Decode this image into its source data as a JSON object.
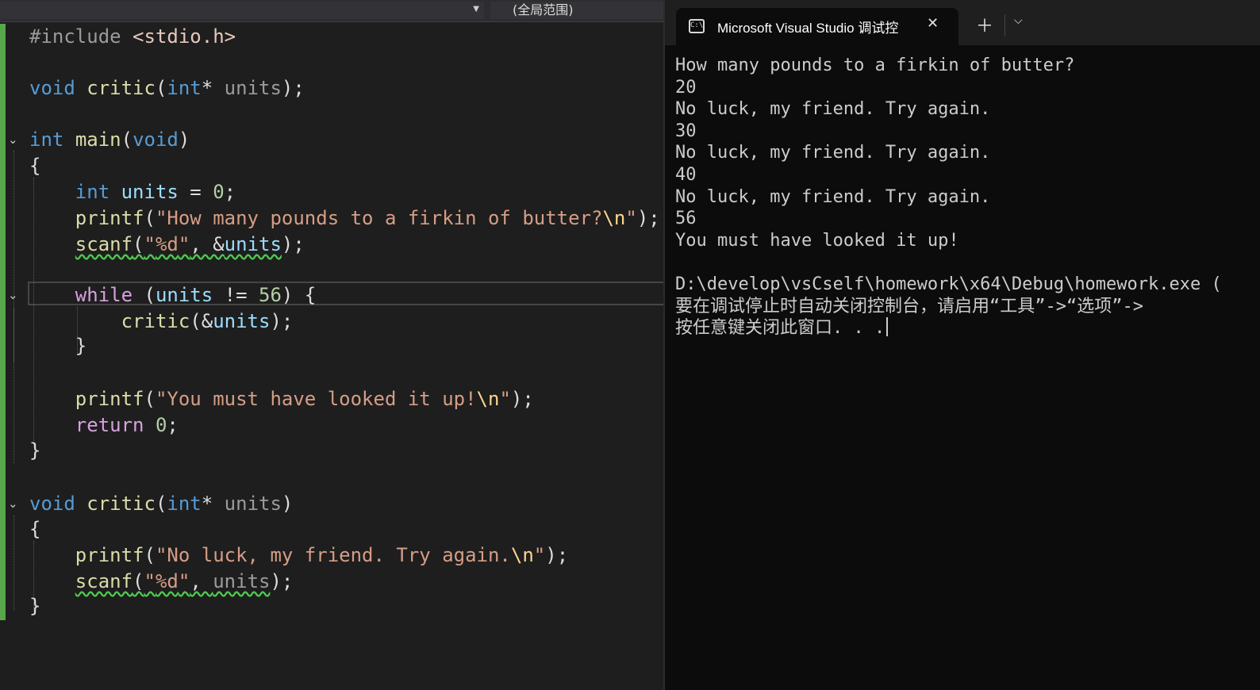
{
  "editor": {
    "scope_label": "(全局范围)",
    "lines": {
      "l1_directive": "#include",
      "l1_header": "<stdio.h>",
      "l3_type": "void",
      "l3_func": "critic",
      "l3_param_type": "int",
      "l3_param": "units",
      "l5_type": "int",
      "l5_func": "main",
      "l5_void": "void",
      "l7_type": "int",
      "l7_var": "units",
      "l7_val": "0",
      "l8_func": "printf",
      "l8_str": "How many pounds to a firkin of butter?",
      "l9_func": "scanf",
      "l9_fmt": "%d",
      "l9_var": "units",
      "l11_kw": "while",
      "l11_var": "units",
      "l11_val": "56",
      "l12_func": "critic",
      "l12_var": "units",
      "l15_func": "printf",
      "l15_str": "You must have looked it up!",
      "l16_kw": "return",
      "l16_val": "0",
      "l19_type": "void",
      "l19_func": "critic",
      "l19_param_type": "int",
      "l19_param": "units",
      "l21_func": "printf",
      "l21_str": "No luck, my friend. Try again.",
      "l22_func": "scanf",
      "l22_fmt": "%d",
      "l22_var": "units",
      "escape": "\\n"
    }
  },
  "terminal": {
    "tab_title": "Microsoft Visual Studio 调试控",
    "tab_icon": "console-icon",
    "output": [
      "How many pounds to a firkin of butter?",
      "20",
      "No luck, my friend. Try again.",
      "30",
      "No luck, my friend. Try again.",
      "40",
      "No luck, my friend. Try again.",
      "56",
      "You must have looked it up!",
      "",
      "D:\\develop\\vsCself\\homework\\x64\\Debug\\homework.exe (",
      "要在调试停止时自动关闭控制台，请启用“工具”->“选项”->",
      "按任意键关闭此窗口. . ."
    ]
  },
  "colors": {
    "keyword": "#569cd6",
    "control_keyword": "#d8a0df",
    "function": "#dcdcaa",
    "variable": "#9cdcfe",
    "string": "#d69d85",
    "number": "#b5cea8",
    "change_bar": "#57a64a"
  }
}
